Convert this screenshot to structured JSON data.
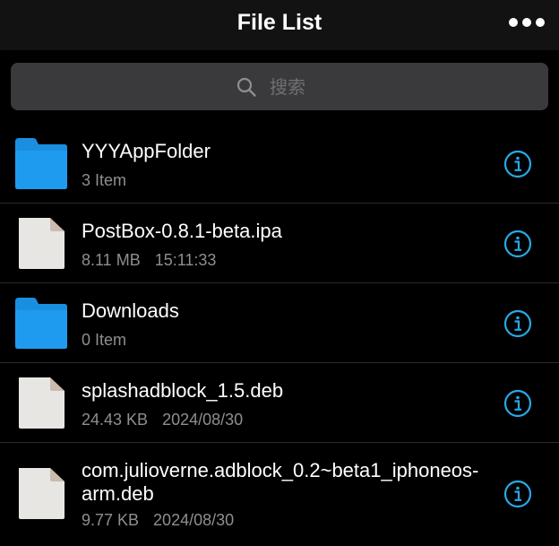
{
  "navbar": {
    "title": "File List",
    "more_icon": "more-horizontal-icon"
  },
  "search": {
    "placeholder": "搜索",
    "value": "",
    "icon": "search-icon"
  },
  "colors": {
    "background": "#000000",
    "navbar_bg": "#121212",
    "search_bg": "#3a3a3c",
    "folder_blue": "#1a8fe0",
    "file_gray": "#e8e6e2",
    "info_blue": "#2aa8e6",
    "secondary_text": "#8e8e93"
  },
  "files": [
    {
      "name": "YYYAppFolder",
      "type": "folder",
      "size": "3 Item",
      "date": ""
    },
    {
      "name": "PostBox-0.8.1-beta.ipa",
      "type": "file",
      "size": "8.11 MB",
      "date": "15:11:33"
    },
    {
      "name": "Downloads",
      "type": "folder",
      "size": "0 Item",
      "date": ""
    },
    {
      "name": "splashadblock_1.5.deb",
      "type": "file",
      "size": "24.43 KB",
      "date": "2024/08/30"
    },
    {
      "name": "com.julioverne.adblock_0.2~beta1_iphoneos-arm.deb",
      "type": "file",
      "size": "9.77 KB",
      "date": "2024/08/30"
    }
  ]
}
